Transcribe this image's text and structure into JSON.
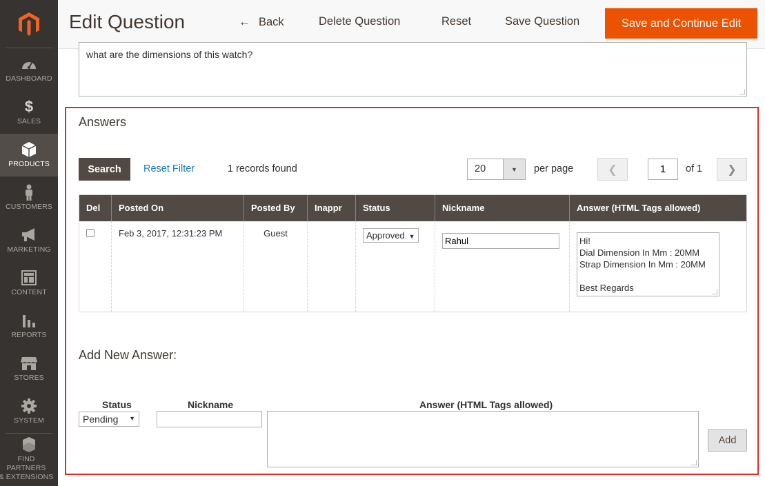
{
  "sidebar": {
    "items": [
      {
        "label": "DASHBOARD",
        "icon": "gauge-icon"
      },
      {
        "label": "SALES",
        "icon": "dollar-icon"
      },
      {
        "label": "PRODUCTS",
        "icon": "box-icon",
        "active": true
      },
      {
        "label": "CUSTOMERS",
        "icon": "person-icon"
      },
      {
        "label": "MARKETING",
        "icon": "megaphone-icon"
      },
      {
        "label": "CONTENT",
        "icon": "layout-icon"
      },
      {
        "label": "REPORTS",
        "icon": "bar-chart-icon"
      },
      {
        "label": "STORES",
        "icon": "storefront-icon"
      },
      {
        "label": "SYSTEM",
        "icon": "gear-icon"
      }
    ],
    "partners_line1": "FIND PARTNERS",
    "partners_line2": "& EXTENSIONS"
  },
  "header": {
    "title": "Edit Question",
    "back": "Back",
    "delete": "Delete Question",
    "reset": "Reset",
    "save": "Save Question",
    "save_continue": "Save and Continue Edit"
  },
  "question": {
    "text": "what are the dimensions of this watch?"
  },
  "answers": {
    "title": "Answers",
    "search": "Search",
    "reset_filter": "Reset Filter",
    "records": "1 records found",
    "per_page_value": "20",
    "per_page_label": "per page",
    "page": "1",
    "of_pages": "of 1",
    "columns": [
      "Del",
      "Posted On",
      "Posted By",
      "Inappr",
      "Status",
      "Nickname",
      "Answer (HTML Tags allowed)"
    ],
    "rows": [
      {
        "posted_on": "Feb 3, 2017, 12:31:23 PM",
        "posted_by": "Guest",
        "inappr": "",
        "status": "Approved",
        "nickname": "Rahul",
        "answer": "Hi!\nDial Dimension In Mm : 20MM\nStrap Dimension In Mm : 20MM\n\nBest Regards"
      }
    ]
  },
  "add_new": {
    "title": "Add New Answer:",
    "status_label": "Status",
    "status_value": "Pending",
    "nickname_label": "Nickname",
    "answer_label": "Answer (HTML Tags allowed)",
    "add": "Add"
  },
  "colors": {
    "accent": "#eb5202",
    "sidebar": "#373330",
    "table_header": "#514943",
    "highlight": "#e02b27",
    "link": "#1979c3"
  }
}
